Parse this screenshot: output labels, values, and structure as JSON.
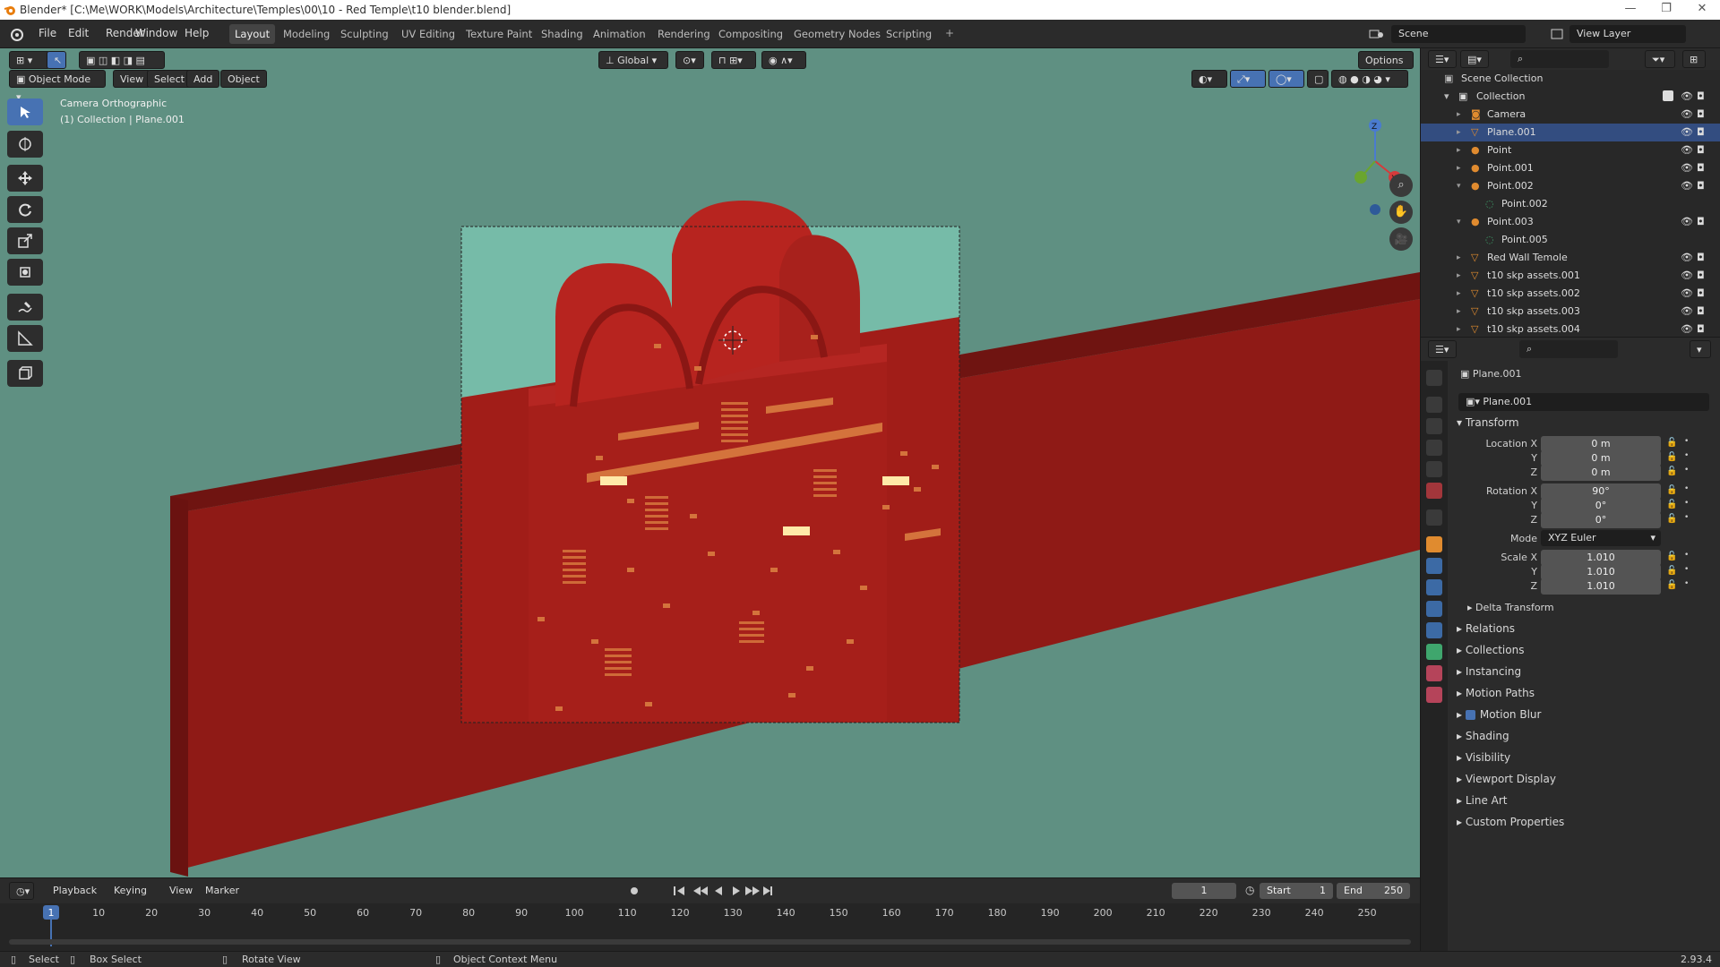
{
  "window": {
    "title": "Blender* [C:\\Me\\WORK\\Models\\Architecture\\Temples\\00\\10 - Red Temple\\t10 blender.blend]"
  },
  "menu": [
    "File",
    "Edit",
    "Render",
    "Window",
    "Help"
  ],
  "workspaces": [
    "Layout",
    "Modeling",
    "Sculpting",
    "UV Editing",
    "Texture Paint",
    "Shading",
    "Animation",
    "Rendering",
    "Compositing",
    "Geometry Nodes",
    "Scripting"
  ],
  "active_workspace": "Layout",
  "scene": {
    "name": "Scene",
    "view_layer": "View Layer"
  },
  "viewport": {
    "mode": "Object Mode",
    "menus": [
      "View",
      "Select",
      "Add",
      "Object"
    ],
    "orientation": "Global",
    "options_label": "Options",
    "overlay_line1": "Camera Orthographic",
    "overlay_line2": "(1) Collection | Plane.001",
    "bg_color": "#5f9082",
    "axis_z": "Z",
    "axis_x": "X"
  },
  "outliner": {
    "root": "Scene Collection",
    "collection": "Collection",
    "items": [
      {
        "name": "Camera",
        "type": "camera",
        "indent": 1,
        "selected": false,
        "expanded": false
      },
      {
        "name": "Plane.001",
        "type": "mesh",
        "indent": 1,
        "selected": true,
        "expanded": false
      },
      {
        "name": "Point",
        "type": "light",
        "indent": 1,
        "selected": false,
        "expanded": false
      },
      {
        "name": "Point.001",
        "type": "light",
        "indent": 1,
        "selected": false,
        "expanded": false
      },
      {
        "name": "Point.002",
        "type": "light",
        "indent": 1,
        "selected": false,
        "expanded": true
      },
      {
        "name": "Point.002",
        "type": "lightdata",
        "indent": 2,
        "selected": false,
        "expanded": false
      },
      {
        "name": "Point.003",
        "type": "light",
        "indent": 1,
        "selected": false,
        "expanded": true
      },
      {
        "name": "Point.005",
        "type": "lightdata",
        "indent": 2,
        "selected": false,
        "expanded": false
      },
      {
        "name": "Red Wall Temole",
        "type": "mesh",
        "indent": 1,
        "selected": false,
        "expanded": false
      },
      {
        "name": "t10 skp assets.001",
        "type": "mesh",
        "indent": 1,
        "selected": false,
        "expanded": false
      },
      {
        "name": "t10 skp assets.002",
        "type": "mesh",
        "indent": 1,
        "selected": false,
        "expanded": false
      },
      {
        "name": "t10 skp assets.003",
        "type": "mesh",
        "indent": 1,
        "selected": false,
        "expanded": false
      },
      {
        "name": "t10 skp assets.004",
        "type": "mesh",
        "indent": 1,
        "selected": false,
        "expanded": false
      }
    ]
  },
  "properties": {
    "object_name": "Plane.001",
    "datablock": "Plane.001",
    "transform_label": "Transform",
    "location_label": "Location X",
    "rotation_label": "Rotation X",
    "scale_label": "Scale X",
    "y_label": "Y",
    "z_label": "Z",
    "location": [
      "0 m",
      "0 m",
      "0 m"
    ],
    "rotation": [
      "90°",
      "0°",
      "0°"
    ],
    "mode_label": "Mode",
    "mode_value": "XYZ Euler",
    "scale": [
      "1.010",
      "1.010",
      "1.010"
    ],
    "delta_transform": "Delta Transform",
    "panels": [
      "Relations",
      "Collections",
      "Instancing",
      "Motion Paths",
      "Motion Blur",
      "Shading",
      "Visibility",
      "Viewport Display",
      "Line Art",
      "Custom Properties"
    ]
  },
  "timeline": {
    "menus": [
      "Playback",
      "Keying",
      "View",
      "Marker"
    ],
    "current_frame": "1",
    "start_label": "Start",
    "start": "1",
    "end_label": "End",
    "end": "250",
    "ticks": [
      "1",
      "10",
      "20",
      "30",
      "40",
      "50",
      "60",
      "70",
      "80",
      "90",
      "100",
      "110",
      "120",
      "130",
      "140",
      "150",
      "160",
      "170",
      "180",
      "190",
      "200",
      "210",
      "220",
      "230",
      "240",
      "250"
    ]
  },
  "status": {
    "select": "Select",
    "box_select": "Box Select",
    "rotate": "Rotate View",
    "context": "Object Context Menu",
    "version": "2.93.4"
  }
}
